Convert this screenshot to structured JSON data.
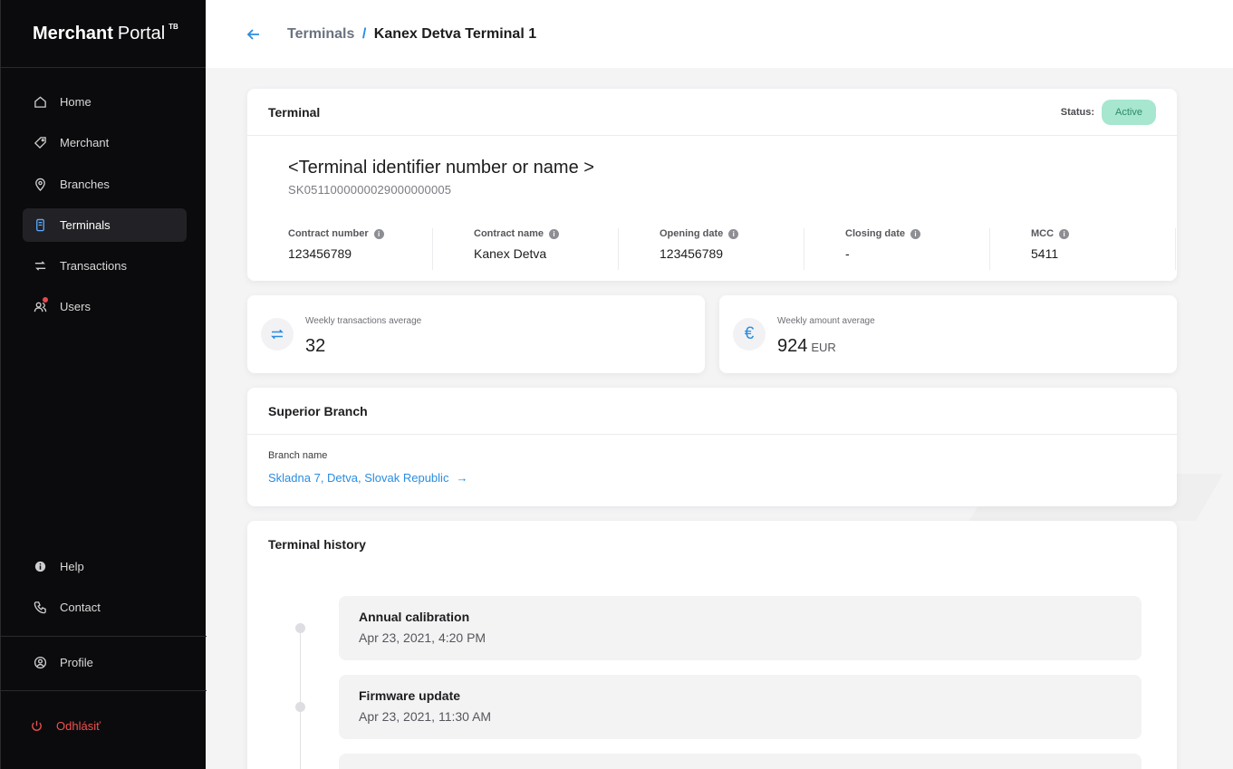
{
  "brand": {
    "bold": "Merchant",
    "regular": "Portal",
    "sup": "TB"
  },
  "nav": {
    "items": [
      {
        "label": "Home",
        "icon": "home-icon"
      },
      {
        "label": "Merchant",
        "icon": "tag-icon"
      },
      {
        "label": "Branches",
        "icon": "map-pin-icon"
      },
      {
        "label": "Terminals",
        "icon": "terminal-icon"
      },
      {
        "label": "Transactions",
        "icon": "transfer-icon"
      },
      {
        "label": "Users",
        "icon": "users-icon"
      }
    ],
    "help": "Help",
    "contact": "Contact",
    "profile": "Profile",
    "logout": "Odhlásiť"
  },
  "header": {
    "crumb_parent": "Terminals",
    "crumb_sep": "/",
    "crumb_current": "Kanex Detva Terminal 1"
  },
  "terminal": {
    "title": "Terminal",
    "status_label": "Status:",
    "status_value": "Active",
    "name": "<Terminal identifier number or name >",
    "id": "SK0511000000029000000005",
    "fields": [
      {
        "label": "Contract number",
        "value": "123456789"
      },
      {
        "label": "Contract name",
        "value": "Kanex Detva"
      },
      {
        "label": "Opening date",
        "value": "123456789"
      },
      {
        "label": "Closing date",
        "value": "-"
      },
      {
        "label": "MCC",
        "value": "5411"
      }
    ]
  },
  "kpis": {
    "transactions": {
      "label": "Weekly transactions average",
      "value": "32"
    },
    "amount": {
      "label": "Weekly amount average",
      "value": "924",
      "unit": "EUR"
    }
  },
  "branch": {
    "title": "Superior Branch",
    "label": "Branch name",
    "value": "Skladna 7, Detva, Slovak Republic",
    "arrow": "→"
  },
  "history": {
    "title": "Terminal history",
    "events": [
      {
        "title": "Annual calibration",
        "time": "Apr 23, 2021, 4:20 PM"
      },
      {
        "title": "Firmware update",
        "time": "Apr 23, 2021, 11:30 AM"
      }
    ]
  },
  "colors": {
    "accent": "#2a8de0",
    "active_bg": "#a7e6cf",
    "logout": "#f0524f",
    "sidebar_bg": "#0b0b0d"
  }
}
